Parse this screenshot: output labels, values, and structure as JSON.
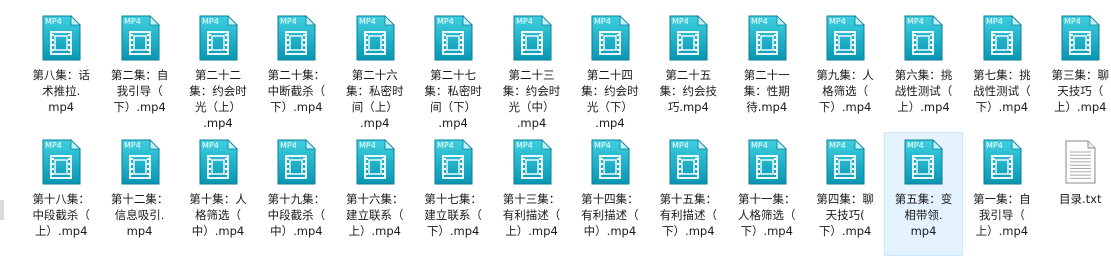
{
  "files": [
    {
      "lines": [
        "第八集：话",
        "术推拉.",
        "mp4"
      ],
      "type": "mp4"
    },
    {
      "lines": [
        "第二集：自",
        "我引导（",
        "下）.mp4"
      ],
      "type": "mp4"
    },
    {
      "lines": [
        "第二十二",
        "集：约会时",
        "光（上）",
        ".mp4"
      ],
      "type": "mp4"
    },
    {
      "lines": [
        "第二十集：",
        "中断截杀（",
        "下）.mp4"
      ],
      "type": "mp4"
    },
    {
      "lines": [
        "第二十六",
        "集：私密时",
        "间（上）",
        ".mp4"
      ],
      "type": "mp4"
    },
    {
      "lines": [
        "第二十七",
        "集：私密时",
        "间（下）",
        ".mp4"
      ],
      "type": "mp4"
    },
    {
      "lines": [
        "第二十三",
        "集：约会时",
        "光（中）",
        ".mp4"
      ],
      "type": "mp4"
    },
    {
      "lines": [
        "第二十四",
        "集：约会时",
        "光（下）",
        ".mp4"
      ],
      "type": "mp4"
    },
    {
      "lines": [
        "第二十五",
        "集：约会技",
        "巧.mp4"
      ],
      "type": "mp4"
    },
    {
      "lines": [
        "第二十一",
        "集：性期",
        "待.mp4"
      ],
      "type": "mp4"
    },
    {
      "lines": [
        "第九集：人",
        "格筛选（",
        "下）.mp4"
      ],
      "type": "mp4"
    },
    {
      "lines": [
        "第六集：挑",
        "战性测试（",
        "上）.mp4"
      ],
      "type": "mp4"
    },
    {
      "lines": [
        "第七集：挑",
        "战性测试（",
        "下）.mp4"
      ],
      "type": "mp4"
    },
    {
      "lines": [
        "第三集：聊",
        "天技巧（",
        "上）.mp4"
      ],
      "type": "mp4"
    },
    {
      "lines": [
        "第十八集：",
        "中段截杀（",
        "上）.mp4"
      ],
      "type": "mp4"
    },
    {
      "lines": [
        "第十二集：",
        "信息吸引.",
        "mp4"
      ],
      "type": "mp4"
    },
    {
      "lines": [
        "第十集：人",
        "格筛选（",
        "中）.mp4"
      ],
      "type": "mp4"
    },
    {
      "lines": [
        "第十九集：",
        "中段截杀（",
        "中）.mp4"
      ],
      "type": "mp4"
    },
    {
      "lines": [
        "第十六集：",
        "建立联系（",
        "上）.mp4"
      ],
      "type": "mp4"
    },
    {
      "lines": [
        "第十七集：",
        "建立联系（",
        "下）.mp4"
      ],
      "type": "mp4"
    },
    {
      "lines": [
        "第十三集：",
        "有利描述（",
        "上）.mp4"
      ],
      "type": "mp4"
    },
    {
      "lines": [
        "第十四集：",
        "有利描述（",
        "中）.mp4"
      ],
      "type": "mp4"
    },
    {
      "lines": [
        "第十五集：",
        "有利描述（",
        "下）.mp4"
      ],
      "type": "mp4"
    },
    {
      "lines": [
        "第十一集：",
        "人格筛选（",
        "下）.mp4"
      ],
      "type": "mp4"
    },
    {
      "lines": [
        "第四集：聊",
        "天技巧(",
        "下）.mp4"
      ],
      "type": "mp4"
    },
    {
      "lines": [
        "第五集：变",
        "相带领.",
        "mp4"
      ],
      "type": "mp4",
      "selected": true
    },
    {
      "lines": [
        "第一集：自",
        "我引导（",
        "上）.mp4"
      ],
      "type": "mp4"
    },
    {
      "lines": [
        "目录.txt"
      ],
      "type": "txt"
    }
  ],
  "badge_text": "MP4",
  "colors": {
    "mp4_top": "#3ed0e0",
    "mp4_bottom": "#0a96b4",
    "selected_bg": "#e5f3ff"
  }
}
